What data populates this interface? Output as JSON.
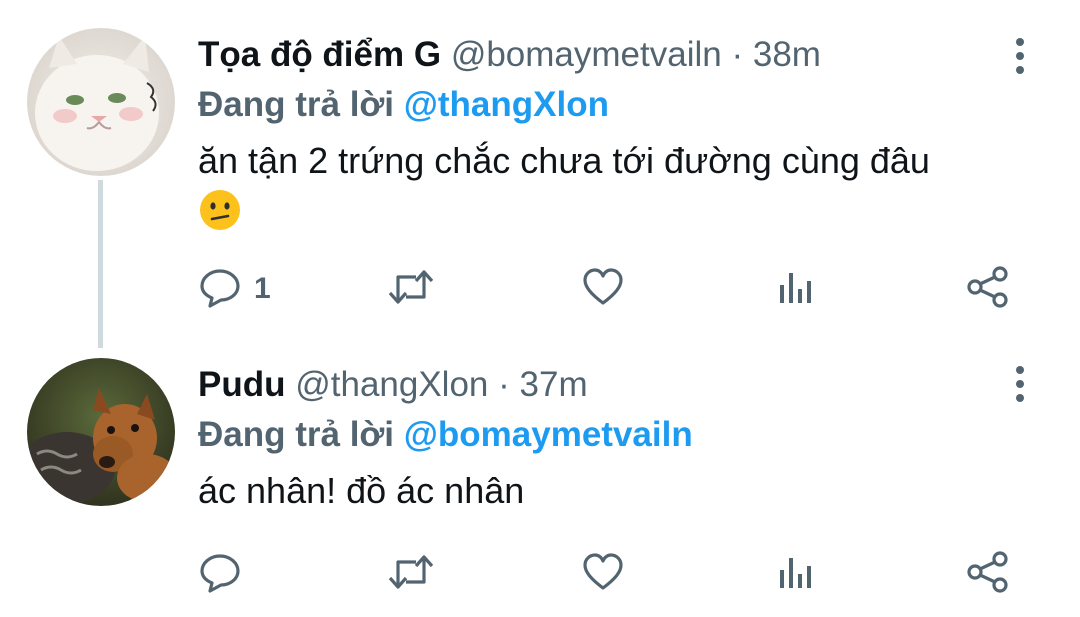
{
  "tweets": [
    {
      "display_name": "Tọa độ điểm G",
      "handle": "@bomaymetvailn",
      "separator": "·",
      "time": "38m",
      "reply_prefix": "Đang trả lời",
      "reply_to": "@thangXlon",
      "text": "ăn tận 2 trứng chắc chưa tới đường cùng đâu",
      "emoji": "confused-face-emoji",
      "reply_count": "1",
      "avatar": "white-cat-avatar"
    },
    {
      "display_name": "Pudu",
      "handle": "@thangXlon",
      "separator": "·",
      "time": "37m",
      "reply_prefix": "Đang trả lời",
      "reply_to": "@bomaymetvailn",
      "text": "ác nhân! đồ ác nhân",
      "reply_count": "",
      "avatar": "pudu-deer-avatar"
    }
  ],
  "icons": {
    "reply": "reply-icon",
    "retweet": "retweet-icon",
    "like": "heart-icon",
    "views": "views-icon",
    "share": "share-icon",
    "more": "more-vertical-icon"
  },
  "colors": {
    "text": "#0f1419",
    "secondary": "#536471",
    "mention": "#1d9bf0",
    "thread_line": "#cfd9de"
  }
}
